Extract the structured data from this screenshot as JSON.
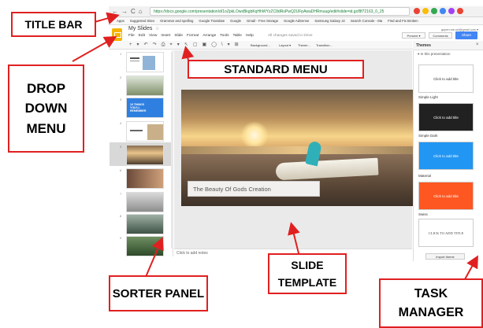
{
  "browser": {
    "url": "https://docs.google.com/presentation/d/1oZpkLOwxBkgbKqHhWYzZC8dRoPwQ2UFpAwaDHRmuug/edit#slide=id.gcf8f72163_0_25",
    "nav": [
      "←",
      "→",
      "C",
      "⌂"
    ],
    "bookmarks": [
      "Apps",
      "Suggested Sites",
      "Grammar and spelling",
      "Google Translate",
      "Google",
      "Gmail - Free Storage",
      "Google AdSense",
      "Samsung Galaxy J2",
      "Search Console - Ma",
      "Find and Fix Broken"
    ],
    "ext_colors": [
      "#ea4335",
      "#fbbc05",
      "#34a853",
      "#4285f4",
      "#a142f4",
      "#ea4335"
    ]
  },
  "app": {
    "title": "My Slides",
    "star": "☆",
    "menus": [
      "File",
      "Edit",
      "View",
      "Insert",
      "Slide",
      "Format",
      "Arrange",
      "Tools",
      "Table",
      "Help"
    ],
    "saved": "All changes saved in Drive",
    "email": "gopen.me.sel@gmail.com ▾",
    "present": "Present ▾",
    "comments": "Comments",
    "share": "Share"
  },
  "toolbar": {
    "icons": [
      "+",
      "▾",
      "↶",
      "↷",
      "⎙",
      "⌖",
      "▾",
      "↖",
      "▢",
      "▣",
      "◯",
      "\\",
      "▾",
      "⊞"
    ],
    "background": "Background...",
    "layout": "Layout ▾",
    "theme": "Theme...",
    "transition": "Transition..."
  },
  "sorter": {
    "numbers": [
      "1",
      "2",
      "3",
      "4",
      "5",
      "6",
      "7",
      "8",
      "9"
    ],
    "slide3_text": "10 THINGS YOU'LL REMEMBER"
  },
  "slide": {
    "title": "The Beauty Of Gods Creation"
  },
  "notes": {
    "text": "Click to add notes"
  },
  "themes": {
    "title": "Themes",
    "close": "×",
    "section": "▾ In this presentation",
    "cards": [
      {
        "name": "Simple Light",
        "text": "Click to add title",
        "bg": "#ffffff",
        "fg": "#333333"
      },
      {
        "name": "Simple Dark",
        "text": "Click to add title",
        "bg": "#212121",
        "fg": "#ffffff"
      },
      {
        "name": "Material",
        "text": "Click to add title",
        "bg": "#2196f3",
        "fg": "#ffffff"
      },
      {
        "name": "Swiss",
        "text": "Click to add title",
        "bg": "#ff5722",
        "fg": "#ffffff"
      },
      {
        "name": "",
        "text": "CLICK TO ADD TITLE",
        "bg": "#ffffff",
        "fg": "#444444"
      }
    ],
    "import": "Import theme"
  },
  "labels": {
    "title_bar": "TITLE BAR",
    "dropdown": "DROP DOWN MENU",
    "standard": "STANDARD MENU",
    "sorter": "SORTER PANEL",
    "template": "SLIDE TEMPLATE",
    "task": "TASK MANAGER"
  },
  "accent": "#e02020"
}
